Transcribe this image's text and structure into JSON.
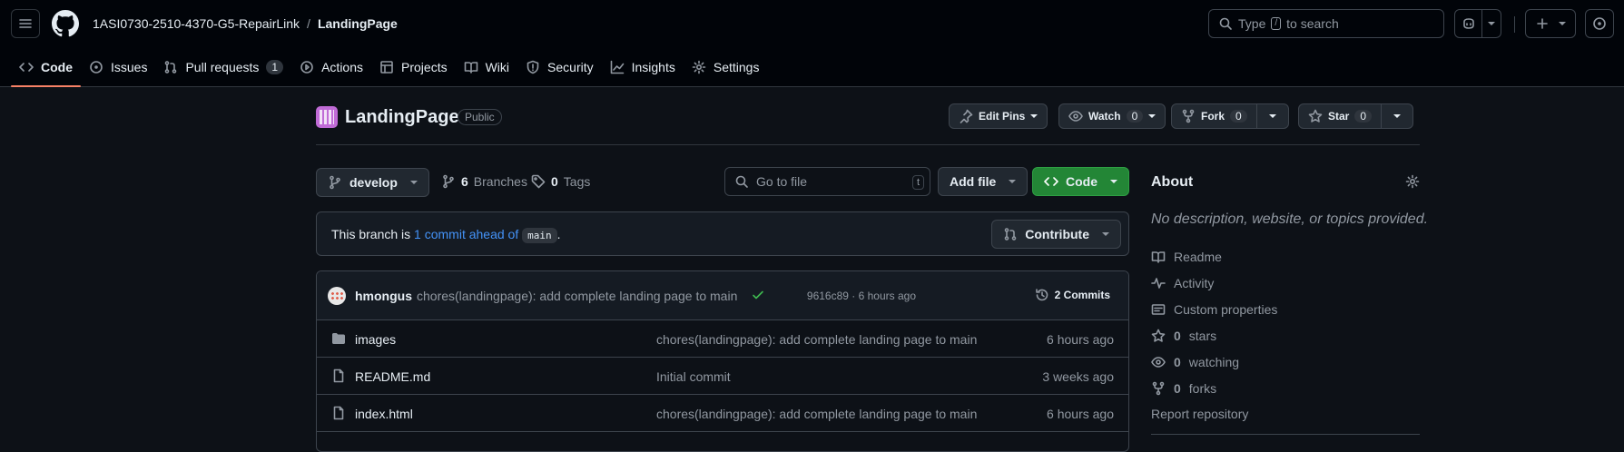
{
  "header": {
    "owner": "1ASI0730-2510-4370-G5-RepairLink",
    "separator": "/",
    "repo": "LandingPage",
    "search_placeholder_before": "Type",
    "search_key": "/",
    "search_placeholder_after": "to search"
  },
  "nav": {
    "tabs": [
      {
        "label": "Code",
        "icon": "code-icon"
      },
      {
        "label": "Issues",
        "icon": "issue-icon"
      },
      {
        "label": "Pull requests",
        "icon": "pull-request-icon",
        "count": "1"
      },
      {
        "label": "Actions",
        "icon": "play-icon"
      },
      {
        "label": "Projects",
        "icon": "table-icon"
      },
      {
        "label": "Wiki",
        "icon": "book-icon"
      },
      {
        "label": "Security",
        "icon": "shield-icon"
      },
      {
        "label": "Insights",
        "icon": "graph-icon"
      },
      {
        "label": "Settings",
        "icon": "gear-icon"
      }
    ]
  },
  "repo": {
    "name": "LandingPage",
    "visibility": "Public",
    "edit_pins": "Edit Pins",
    "watch": "Watch",
    "watch_count": "0",
    "fork": "Fork",
    "fork_count": "0",
    "star": "Star",
    "star_count": "0"
  },
  "toolbar": {
    "branch": "develop",
    "branches_count": "6",
    "branches_label": "Branches",
    "tags_count": "0",
    "tags_label": "Tags",
    "go_to_file": "Go to file",
    "go_to_file_key": "t",
    "add_file": "Add file",
    "code": "Code"
  },
  "branch_status": {
    "prefix": "This branch is",
    "link": "1 commit ahead of",
    "base": "main",
    "suffix": ".",
    "contribute": "Contribute"
  },
  "latest_commit": {
    "author": "hmongus",
    "message": "chores(landingpage): add complete landing page to main",
    "sha_time": "9616c89 · 6 hours ago",
    "commits": "2 Commits"
  },
  "files": [
    {
      "name": "images",
      "type": "dir",
      "message": "chores(landingpage): add complete landing page to main",
      "age": "6 hours ago"
    },
    {
      "name": "README.md",
      "type": "file",
      "message": "Initial commit",
      "age": "3 weeks ago"
    },
    {
      "name": "index.html",
      "type": "file",
      "message": "chores(landingpage): add complete landing page to main",
      "age": "6 hours ago"
    }
  ],
  "about": {
    "title": "About",
    "description": "No description, website, or topics provided.",
    "items": [
      {
        "label": "Readme",
        "icon": "book-icon"
      },
      {
        "label": "Activity",
        "icon": "pulse-icon"
      },
      {
        "label": "Custom properties",
        "icon": "note-icon"
      },
      {
        "count": "0",
        "label": "stars",
        "icon": "star-icon"
      },
      {
        "count": "0",
        "label": "watching",
        "icon": "eye-icon"
      },
      {
        "count": "0",
        "label": "forks",
        "icon": "fork-icon"
      }
    ],
    "report": "Report repository"
  },
  "colors": {
    "background": "#0d1117",
    "header": "#010409",
    "accent_tab": "#f78166",
    "green_button": "#238636",
    "link": "#4493f8"
  }
}
